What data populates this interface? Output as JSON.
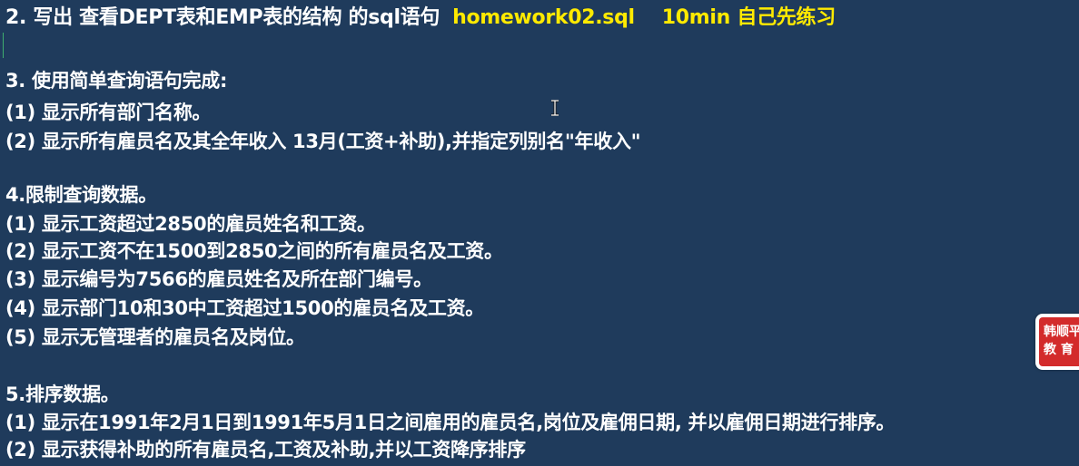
{
  "title": {
    "text": "2. 写出 查看DEPT表和EMP表的结构 的sql语句",
    "file": "homework02.sql",
    "time": "10min 自己先练习"
  },
  "sections": [
    {
      "heading": "3. 使用简单查询语句完成:",
      "items": [
        "(1) 显示所有部门名称。",
        "(2) 显示所有雇员名及其全年收入 13月(工资+补助),并指定列别名\"年收入\""
      ]
    },
    {
      "heading": "4.限制查询数据。",
      "items": [
        "(1) 显示工资超过2850的雇员姓名和工资。",
        "(2) 显示工资不在1500到2850之间的所有雇员名及工资。",
        "(3) 显示编号为7566的雇员姓名及所在部门编号。",
        "(4) 显示部门10和30中工资超过1500的雇员名及工资。",
        "(5) 显示无管理者的雇员名及岗位。"
      ]
    },
    {
      "heading": "5.排序数据。",
      "items": [
        "(1) 显示在1991年2月1日到1991年5月1日之间雇用的雇员名,岗位及雇佣日期, 并以雇佣日期进行排序。",
        "(2) 显示获得补助的所有雇员名,工资及补助,并以工资降序排序"
      ]
    }
  ],
  "badge": {
    "line1": "韩顺平",
    "line2": "教 育"
  },
  "colors": {
    "background": "#1f3b5c",
    "text": "#ffffff",
    "highlight": "#ffea00",
    "badge": "#d32b2b"
  }
}
